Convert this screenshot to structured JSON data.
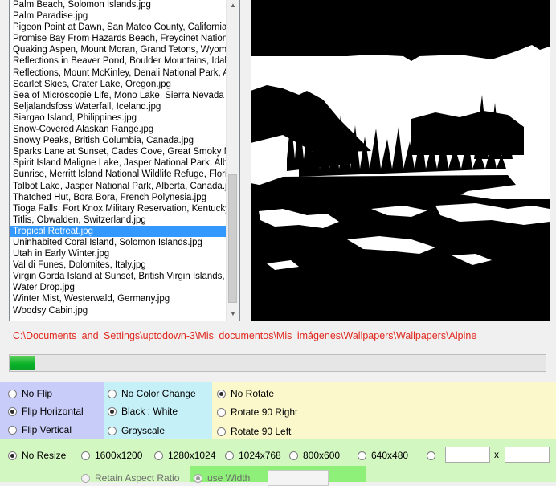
{
  "file_list": {
    "items": [
      "Palm Beach, Solomon Islands.jpg",
      "Palm Paradise.jpg",
      "Pigeon Point at Dawn, San Mateo County, California",
      "Promise Bay From Hazards Beach, Freycinet Nationa",
      "Quaking Aspen, Mount Moran, Grand Tetons, Wyom",
      "Reflections in Beaver Pond, Boulder Mountains, Idah",
      "Reflections, Mount McKinley, Denali National Park, A",
      "Scarlet Skies, Crater Lake, Oregon.jpg",
      "Sea of Microscopie Life, Mono Lake, Sierra Nevada",
      "Seljalandsfoss Waterfall, Iceland.jpg",
      "Siargao Island, Philippines.jpg",
      "Snow-Covered Alaskan Range.jpg",
      "Snowy Peaks, British Columbia, Canada.jpg",
      "Sparks Lane at Sunset, Cades Cove, Great Smoky M",
      "Spirit Island Maligne Lake, Jasper National Park, Alb",
      "Sunrise, Merritt Island National Wildlife Refuge, Floric",
      "Talbot Lake, Jasper National Park, Alberta, Canada.j",
      "Thatched Hut, Bora Bora, French Polynesia.jpg",
      "Tioga Falls, Fort Knox Military Reservation, Kentucky",
      "Titlis, Obwalden, Switzerland.jpg",
      "Tropical Retreat.jpg",
      "Uninhabited Coral Island, Solomon Islands.jpg",
      "Utah in Early Winter.jpg",
      "Val di Funes, Dolomites, Italy.jpg",
      "Virgin Gorda Island at Sunset, British Virgin Islands, V",
      "Water Drop.jpg",
      "Winter Mist, Westerwald, Germany.jpg",
      "Woodsy Cabin.jpg"
    ],
    "selected_index": 20
  },
  "path_text": "C:\\Documents and Settings\\uptodown-3\\Mis documentos\\Mis imágenes\\Wallpapers\\Wallpapers\\Alpine",
  "progress_fraction": 0.045,
  "flip": {
    "options": [
      "No Flip",
      "Flip Horizontal",
      "Flip Vertical"
    ],
    "selected": 1
  },
  "color": {
    "options": [
      "No Color Change",
      "Black : White",
      "Grayscale"
    ],
    "selected": 1
  },
  "rotate": {
    "options": [
      "No Rotate",
      "Rotate 90 Right",
      "Rotate 90 Left"
    ],
    "selected": 0
  },
  "resize": {
    "options": [
      "No Resize",
      "1600x1200",
      "1280x1024",
      "1024x768",
      "800x600",
      "640x480"
    ],
    "selected": 0,
    "custom_width": "",
    "custom_height": "",
    "x_label": "x",
    "retain_aspect_label": "Retain Aspect Ratio",
    "use_width_label": "use Width",
    "use_width_value": ""
  },
  "colors": {
    "path_text": "#e0291f",
    "progress": "#06b025",
    "flip_panel": "#c8ccf8",
    "color_panel": "#c6f0f8",
    "rotate_panel": "#fbf9cc",
    "resize_panel": "#d3f7c0",
    "width_panel": "#8ff079",
    "selection": "#3399ff"
  },
  "icons": {
    "scroll_up": "chevron-up-icon",
    "scroll_down": "chevron-down-icon"
  }
}
